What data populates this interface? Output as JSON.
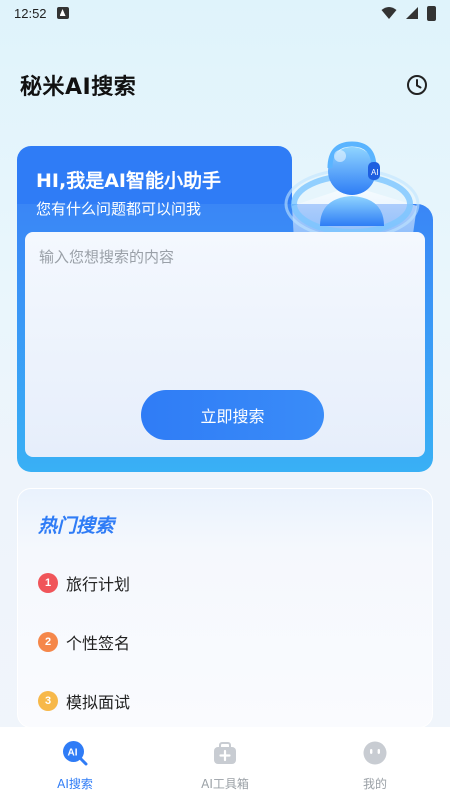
{
  "status_bar": {
    "time": "12:52"
  },
  "header": {
    "title": "秘米AI搜索",
    "history_icon": "clock-icon"
  },
  "hero": {
    "greeting": "HI,我是AI智能小助手",
    "subtitle": "您有什么问题都可以问我",
    "input_placeholder": "输入您想搜索的内容",
    "input_value": "",
    "search_button": "立即搜索"
  },
  "hot_search": {
    "title": "热门搜索",
    "items": [
      {
        "rank": "1",
        "label": "旅行计划",
        "color": "#f0555a"
      },
      {
        "rank": "2",
        "label": "个性签名",
        "color": "#f5874a"
      },
      {
        "rank": "3",
        "label": "模拟面试",
        "color": "#f7b84a"
      }
    ]
  },
  "bottom_nav": {
    "items": [
      {
        "label": "AI搜索",
        "icon": "ai-search-icon",
        "active": true
      },
      {
        "label": "AI工具箱",
        "icon": "toolbox-icon",
        "active": false
      },
      {
        "label": "我的",
        "icon": "profile-icon",
        "active": false
      }
    ]
  },
  "colors": {
    "accent": "#2f7cf6",
    "inactive": "#9aa0a6"
  }
}
